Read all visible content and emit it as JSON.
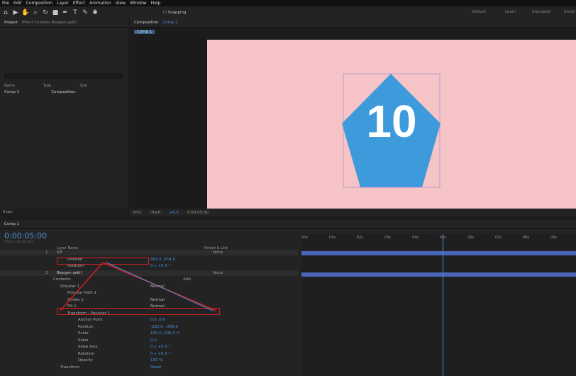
{
  "menu": [
    "File",
    "Edit",
    "Composition",
    "Layer",
    "Effect",
    "Animation",
    "View",
    "Window",
    "Help"
  ],
  "toolbar": {
    "snapping": "Snapping",
    "workspaces": [
      "Default",
      "Learn",
      "Standard",
      "Small"
    ]
  },
  "project": {
    "tab": "Project",
    "effect_tab": "Effect Controls Beygen şekli",
    "cols": [
      "Name",
      "Type",
      "Size",
      "M"
    ],
    "items": [
      {
        "name": "Comp 1",
        "type": "Composition"
      }
    ],
    "bpc": "8 bpc"
  },
  "viewer": {
    "tab": "Composition",
    "comp": "Comp 1",
    "crumb": "Comp 1",
    "zoom": "50%",
    "quality": "(Half)",
    "exposure": "+0,0",
    "time": "0:00:05:00",
    "content": "10"
  },
  "timeline": {
    "tab": "Comp 1",
    "time": "0:00:05:00",
    "frames": "00125 (25.00 fps)",
    "headers": [
      "Layer Name",
      "Parent & Link"
    ],
    "ticks": [
      "00s",
      "01s",
      "02s",
      "03s",
      "04s",
      "05s",
      "06s",
      "07s",
      "08s",
      "09s"
    ],
    "rows": [
      {
        "n": "1",
        "name": "10",
        "mode": "",
        "parent": "None",
        "indent": 40,
        "layer": true
      },
      {
        "name": "Position",
        "val": "962,5 ,554,0",
        "indent": 55
      },
      {
        "name": "Rotation",
        "val": "0 x +0,0 °",
        "indent": 55
      },
      {
        "n": "2",
        "name": "Beygen şekli",
        "parent": "None",
        "indent": 40,
        "layer": true
      },
      {
        "name": "Contents",
        "indent": 35,
        "add": "Add:"
      },
      {
        "name": "Polystar 1",
        "val": "Normal",
        "indent": 45
      },
      {
        "name": "Polystar Path 1",
        "indent": 55
      },
      {
        "name": "Stroke 1",
        "val": "Normal",
        "indent": 55
      },
      {
        "name": "Fill 1",
        "val": "Normal",
        "indent": 55
      },
      {
        "name": "Transform : Polystar 1",
        "indent": 55
      },
      {
        "name": "Anchor Point",
        "val": "0,0 ,0,0",
        "indent": 70
      },
      {
        "name": "Position",
        "val": "-282,0 ,-206,0",
        "indent": 70
      },
      {
        "name": "Scale",
        "val": "100,0 ,100,0 %",
        "indent": 70
      },
      {
        "name": "Skew",
        "val": "0,0",
        "indent": 70
      },
      {
        "name": "Skew Axis",
        "val": "0 x +0,0 °",
        "indent": 70
      },
      {
        "name": "Rotation",
        "val": "0 x +0,0 °",
        "indent": 70
      },
      {
        "name": "Opacity",
        "val": "100 %",
        "indent": 70
      },
      {
        "name": "Transform",
        "val": "Reset",
        "indent": 45
      }
    ]
  }
}
